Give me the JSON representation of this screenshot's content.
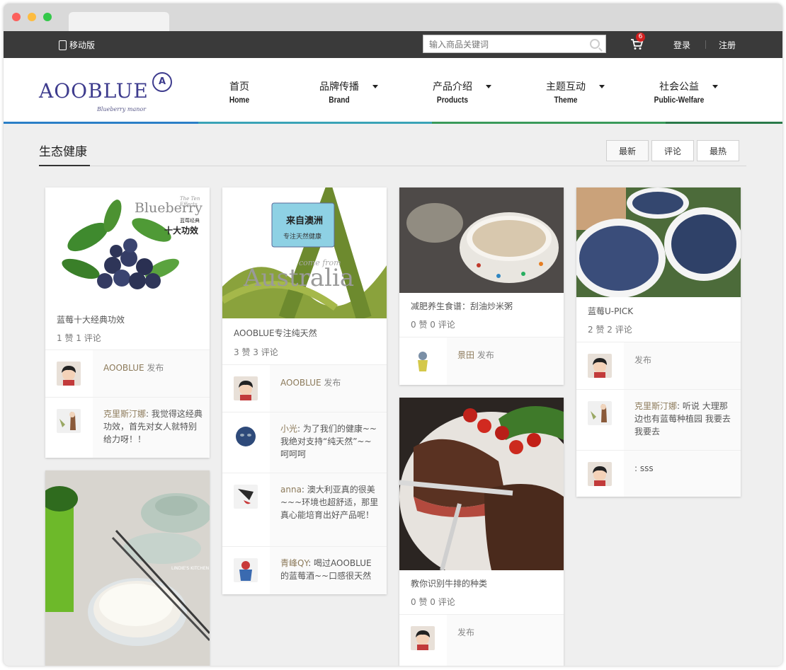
{
  "topbar": {
    "mobile_label": "移动版",
    "search_placeholder": "输入商品关键词",
    "cart_count": "6",
    "login": "登录",
    "register": "注册"
  },
  "logo": {
    "text": "AOOBLUE",
    "sub": "Blueberry manor",
    "mark": "A"
  },
  "nav": [
    {
      "cn": "首页",
      "en": "Home"
    },
    {
      "cn": "品牌传播",
      "en": "Brand"
    },
    {
      "cn": "产品介绍",
      "en": "Products"
    },
    {
      "cn": "主题互动",
      "en": "Theme"
    },
    {
      "cn": "社会公益",
      "en": "Public-Welfare"
    }
  ],
  "section_title": "生态健康",
  "sort_buttons": [
    "最新",
    "评论",
    "最热"
  ],
  "cards": [
    {
      "img_alt": "Blueberry",
      "img_text_big": "Blueberry",
      "img_text_small": "The Ten Effects",
      "img_text_cn1": "蓝莓经典",
      "img_text_cn2": "十大功效",
      "title": "蓝莓十大经典功效",
      "stats": "1 赞 1 评论",
      "rows": [
        {
          "user": "AOOBLUE",
          "text": "发布"
        },
        {
          "user": "克里斯汀娜",
          "text": ": 我觉得这经典功效，首先对女人就特别给力呀！！"
        }
      ]
    },
    {
      "img_text_cn1": "来自澳洲",
      "img_text_cn2": "专注天然健康",
      "img_text_small": "come from",
      "img_text_big": "Australia",
      "title": "AOOBLUE专注纯天然",
      "stats": "3 赞 3 评论",
      "rows": [
        {
          "user": "AOOBLUE",
          "text": "发布"
        },
        {
          "user": "小光",
          "text": ": 为了我们的健康~~我绝对支持“纯天然”~~呵呵呵"
        },
        {
          "user": "anna",
          "text": ": 澳大利亚真的很美~~~环境也超舒适，那里真心能培育出好产品呢！"
        },
        {
          "user": "青峰QY",
          "text": ": 喝过AOOBLUE的蓝莓酒~~口感很天然"
        }
      ]
    },
    {
      "title": "减肥养生食谱：刮油炒米粥",
      "stats": "0 赞 0 评论",
      "rows": [
        {
          "user": "景田",
          "text": "发布"
        }
      ]
    },
    {
      "title": "教你识别牛排的种类",
      "stats": "0 赞 0 评论",
      "rows": [
        {
          "user": "",
          "text": "发布"
        }
      ]
    },
    {
      "title": "蓝莓U-PICK",
      "stats": "2 赞 2 评论",
      "rows": [
        {
          "user": "",
          "text": "发布"
        },
        {
          "user": "克里斯汀娜",
          "text": ": 听说 大理那边也有蓝莓种植园 我要去我要去"
        },
        {
          "user": "",
          "text": ": sss"
        }
      ]
    },
    {
      "img_text_small": "LINDIE'S KITCHEN"
    }
  ],
  "colors": {
    "accent_brand": "#3e3c8e",
    "username": "#8c7a5a",
    "topbar": "#3a3a3a",
    "badge": "#d21f1f"
  }
}
